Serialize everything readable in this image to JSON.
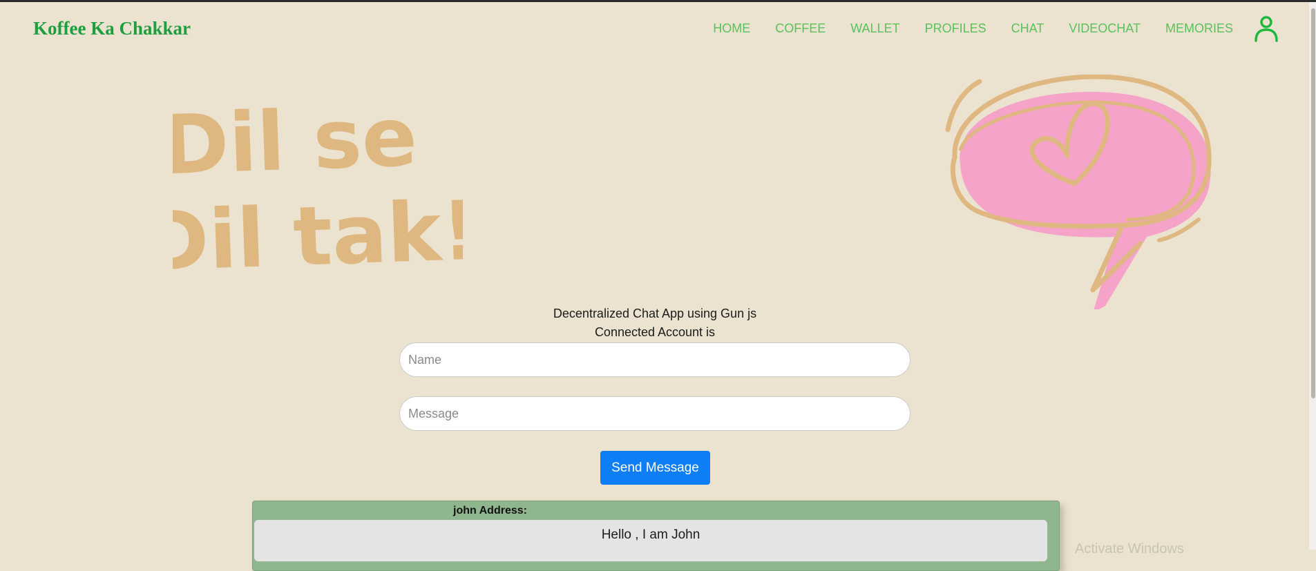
{
  "nav": {
    "brand": "Koffee Ka Chakkar",
    "links": [
      "HOME",
      "COFFEE",
      "WALLET",
      "PROFILES",
      "CHAT",
      "VIDEOCHAT",
      "MEMORIES"
    ]
  },
  "hero": {
    "line1": "Dil se",
    "line2": "Dil tak!"
  },
  "chat": {
    "title": "Decentralized Chat App using Gun js",
    "account": "Connected Account is",
    "name_placeholder": "Name",
    "message_placeholder": "Message",
    "send_label": "Send Message",
    "messages": [
      {
        "sender": "john Address:",
        "text": "Hello , I am John"
      }
    ]
  },
  "overlay": {
    "watermark": "Activate Windows"
  },
  "colors": {
    "background": "#ebe3cf",
    "brand": "#1e9e3f",
    "nav_link": "#59c25c",
    "hero_text": "#dfb781",
    "bubble_fill": "#f5a3c9",
    "button": "#0d7ef6",
    "card": "#8fb68e"
  }
}
